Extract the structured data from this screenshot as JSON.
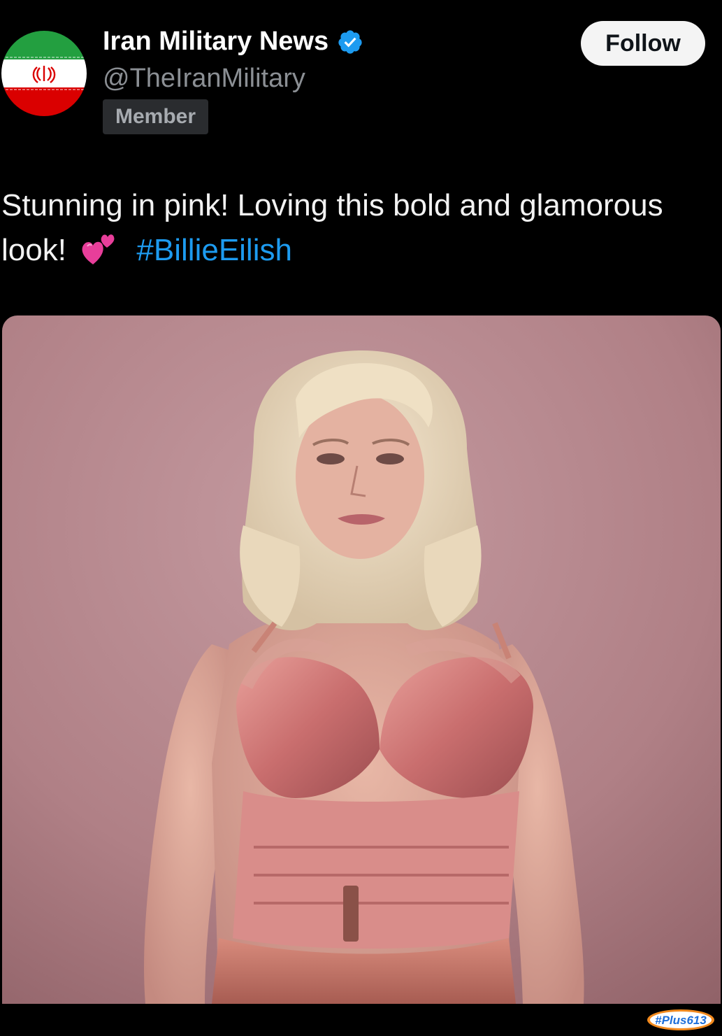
{
  "post": {
    "author": {
      "display_name": "Iran Military News",
      "handle": "@TheIranMilitary",
      "badge": "Member",
      "verified": true,
      "avatar_icon": "iran-flag-icon"
    },
    "follow_label": "Follow",
    "text": "Stunning in pink! Loving this bold and glamorous look!",
    "emoji": "two-hearts-emoji",
    "hashtag": "#BillieEilish",
    "media": {
      "kind": "photo",
      "background_color": "#b98a8e"
    }
  },
  "watermark": {
    "text": "#Plus613",
    "color": "#1e6fd9"
  },
  "colors": {
    "background": "#000000",
    "hashtag": "#1d9bf0",
    "verified": "#1d9bf0",
    "handle": "#8b8f94",
    "follow_bg": "#f4f4f4"
  }
}
